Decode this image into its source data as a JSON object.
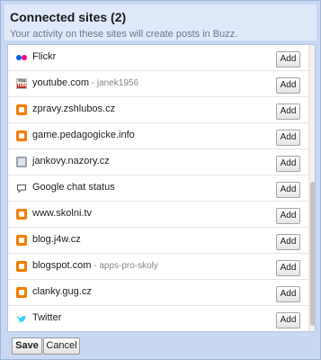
{
  "dialog": {
    "title": "Connected sites (2)",
    "subtitle": "Your activity on these sites will create posts in Buzz."
  },
  "sites": [
    {
      "label": "Flickr",
      "detail": "",
      "icon": "flickr-icon",
      "button": "Add"
    },
    {
      "label": "youtube.com",
      "detail": " - janek1956",
      "icon": "youtube-icon",
      "button": "Add"
    },
    {
      "label": "zpravy.zshlubos.cz",
      "detail": "",
      "icon": "blogger-icon",
      "button": "Add"
    },
    {
      "label": "game.pedagogicke.info",
      "detail": "",
      "icon": "blogger-icon",
      "button": "Add"
    },
    {
      "label": "jankovy.nazory.cz",
      "detail": "",
      "icon": "website-icon",
      "button": "Add"
    },
    {
      "label": "Google chat status",
      "detail": "",
      "icon": "chat-bubble-icon",
      "button": "Add"
    },
    {
      "label": "www.skolni.tv",
      "detail": "",
      "icon": "blogger-icon",
      "button": "Add"
    },
    {
      "label": "blog.j4w.cz",
      "detail": "",
      "icon": "blogger-icon",
      "button": "Add"
    },
    {
      "label": "blogspot.com",
      "detail": " - apps-pro-skoly",
      "icon": "blogger-icon",
      "button": "Add"
    },
    {
      "label": "clanky.gug.cz",
      "detail": "",
      "icon": "blogger-icon",
      "button": "Add"
    },
    {
      "label": "Twitter",
      "detail": "",
      "icon": "twitter-icon",
      "button": "Add"
    }
  ],
  "footer": {
    "save_label": "Save",
    "cancel_label": "Cancel"
  },
  "colors": {
    "dialog_background": "#c8d8f3",
    "header_background": "#dfe9fa",
    "blogger_orange": "#f57d00",
    "flickr_blue": "#0063dc",
    "flickr_pink": "#ff0084",
    "twitter_blue": "#33ccff"
  }
}
